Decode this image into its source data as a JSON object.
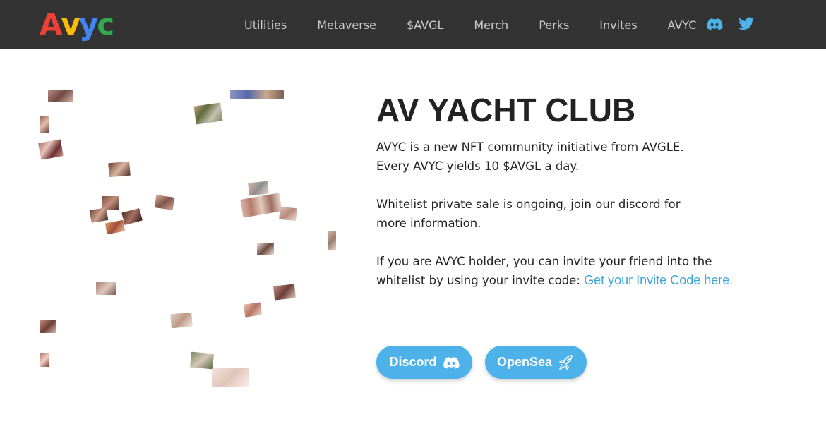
{
  "nav": {
    "logo": {
      "letters": [
        "A",
        "v",
        "y",
        "c"
      ],
      "colors": [
        "#ea4335",
        "#fbbc05",
        "#4285f4",
        "#34a853"
      ]
    },
    "links": [
      "Utilities",
      "Metaverse",
      "$AVGL",
      "Merch",
      "Perks",
      "Invites",
      "AVYC"
    ],
    "social": [
      {
        "icon": "discord-icon",
        "color": "#4db2ea"
      },
      {
        "icon": "twitter-icon",
        "color": "#4db2ea"
      }
    ]
  },
  "hero": {
    "title": "AV YACHT CLUB",
    "intro_line1": "AVYC is a new NFT community initiative from AVGLE.",
    "intro_line2": "Every AVYC yields 10 $AVGL a day.",
    "whitelist_text": "Whitelist private sale is ongoing, join our discord for more information.",
    "invite_text": "If you are AVYC holder, you can invite your friend into the whitelist by using your invite code:",
    "invite_link": "Get your Invite Code here.",
    "buttons": {
      "discord": "Discord",
      "opensea": "OpenSea"
    }
  },
  "colors": {
    "nav_bg": "#333333",
    "accent": "#4db2ea",
    "link": "#3aa7db",
    "text": "#222222"
  }
}
